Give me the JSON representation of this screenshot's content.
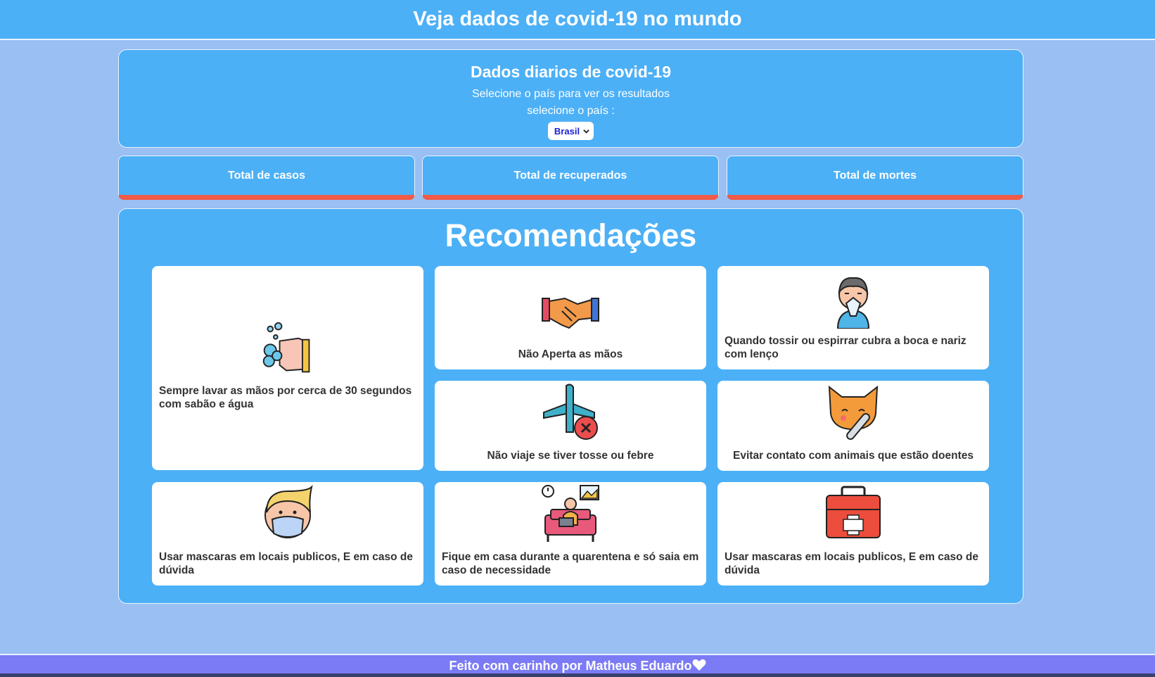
{
  "header": {
    "title": "Veja dados de covid-19 no mundo"
  },
  "daily": {
    "title": "Dados diarios de covid-19",
    "subtitle": "Selecione o país para ver os resultados",
    "select_label": "selecione o país :",
    "selected_country": "Brasil"
  },
  "stats": [
    {
      "label": "Total de casos"
    },
    {
      "label": "Total de recuperados"
    },
    {
      "label": "Total de mortes"
    }
  ],
  "recommendations": {
    "title": "Recomendações",
    "items": [
      {
        "text": "Sempre lavar as mãos por cerca de 30 segundos com sabão e água",
        "icon": "hand-washing-icon"
      },
      {
        "text": "Não Aperta as mãos",
        "icon": "handshake-icon"
      },
      {
        "text": "Quando tossir ou espirrar cubra a boca e nariz com lenço",
        "icon": "sneezing-person-icon"
      },
      {
        "text": "Não viaje se tiver tosse ou febre",
        "icon": "no-travel-airplane-icon"
      },
      {
        "text": "Evitar contato com animais que estão doentes",
        "icon": "sick-cat-thermometer-icon"
      },
      {
        "text": "Usar mascaras em locais publicos, E em caso de dúvida",
        "icon": "face-mask-icon"
      },
      {
        "text": "Fique em casa durante a quarentena e só saia em caso de necessidade",
        "icon": "stay-home-icon"
      },
      {
        "text": "Usar mascaras em locais publicos, E em caso de dúvida",
        "icon": "first-aid-kit-icon"
      }
    ]
  },
  "footer": {
    "text": "Feito com carinho por Matheus Eduardo",
    "icon": "heart-icon"
  },
  "colors": {
    "primary": "#4cb0f6",
    "background": "#99bff3",
    "accent": "#f15a47",
    "footer": "#7b7bf6"
  }
}
